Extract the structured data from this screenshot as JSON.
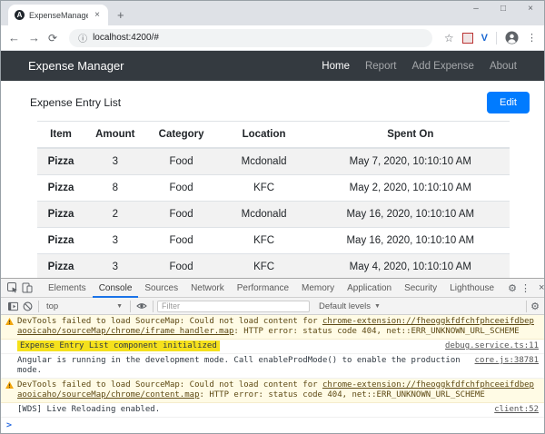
{
  "browser": {
    "tab_title": "ExpenseManager",
    "favicon_letter": "A",
    "url": "localhost:4200/#",
    "ext_red_label": "o",
    "ext_v_label": "V",
    "icons": {
      "back": "←",
      "forward": "→",
      "reload": "⟳",
      "info": "ⓘ",
      "star": "☆",
      "kebab": "⋮",
      "close": "×",
      "plus": "+",
      "minimize": "–",
      "maximize": "□",
      "dropdown": "▼",
      "gear": "⚙",
      "prompt": ">"
    }
  },
  "app": {
    "navbar": {
      "brand": "Expense Manager",
      "links": [
        "Home",
        "Report",
        "Add Expense",
        "About"
      ],
      "active_link": "Home",
      "bg_color": "#343a40"
    },
    "page_title": "Expense Entry List",
    "edit_button": "Edit",
    "accent_color": "#007bff",
    "table": {
      "headers": [
        "Item",
        "Amount",
        "Category",
        "Location",
        "Spent On"
      ],
      "rows": [
        [
          "Pizza",
          "3",
          "Food",
          "Mcdonald",
          "May 7, 2020, 10:10:10 AM"
        ],
        [
          "Pizza",
          "8",
          "Food",
          "KFC",
          "May 2, 2020, 10:10:10 AM"
        ],
        [
          "Pizza",
          "2",
          "Food",
          "Mcdonald",
          "May 16, 2020, 10:10:10 AM"
        ],
        [
          "Pizza",
          "3",
          "Food",
          "KFC",
          "May 16, 2020, 10:10:10 AM"
        ],
        [
          "Pizza",
          "3",
          "Food",
          "KFC",
          "May 4, 2020, 10:10:10 AM"
        ]
      ]
    }
  },
  "devtools": {
    "tabs": [
      "Elements",
      "Console",
      "Sources",
      "Network",
      "Performance",
      "Memory",
      "Application",
      "Security",
      "Lighthouse"
    ],
    "active_tab": "Console",
    "active_tab_color": "#1a73e8",
    "toolbar": {
      "context": "top",
      "filter_placeholder": "Filter",
      "levels_label": "Default levels"
    },
    "messages": [
      {
        "type": "warning",
        "prefix": "DevTools failed to load SourceMap: Could not load content for ",
        "link": "chrome-extension://fheoggkfdfchfphceeifdbepaooicaho/sourceMap/chrome/iframe_handler.map",
        "suffix": ": HTTP error: status code 404, net::ERR_UNKNOWN_URL_SCHEME"
      },
      {
        "type": "log-highlighted",
        "text": "Expense Entry List component initialized",
        "source": "debug.service.ts:11",
        "highlight_color": "#f5e11c"
      },
      {
        "type": "log",
        "text": "Angular is running in the development mode. Call enableProdMode() to enable the production mode.",
        "source": "core.js:38781"
      },
      {
        "type": "warning",
        "prefix": "DevTools failed to load SourceMap: Could not load content for ",
        "link": "chrome-extension://fheoggkfdfchfphceeifdbepaooicaho/sourceMap/chrome/content.map",
        "suffix": ": HTTP error: status code 404, net::ERR_UNKNOWN_URL_SCHEME"
      },
      {
        "type": "log",
        "text": "[WDS] Live Reloading enabled.",
        "source": "client:52"
      }
    ]
  }
}
